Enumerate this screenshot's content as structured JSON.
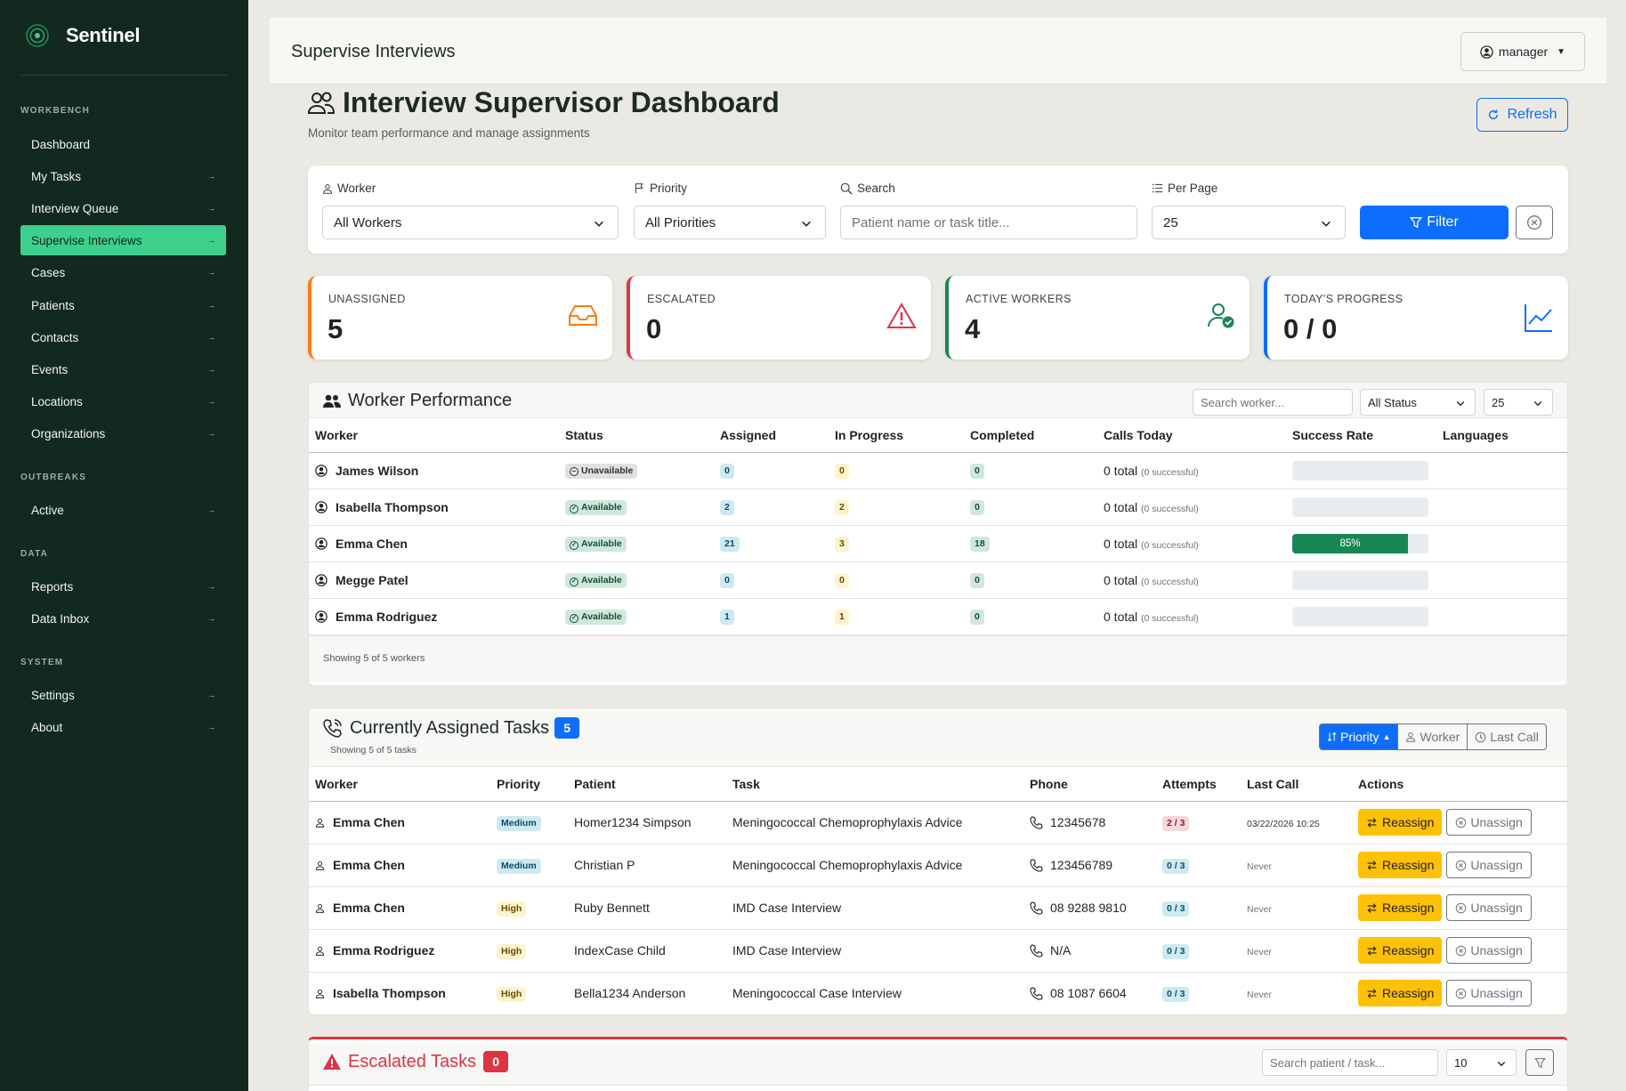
{
  "app": {
    "name": "Sentinel"
  },
  "sidebar": {
    "sections": [
      {
        "label": "WORKBENCH",
        "items": [
          "Dashboard",
          "My Tasks",
          "Interview Queue",
          "Supervise Interviews",
          "Cases",
          "Patients",
          "Contacts",
          "Events",
          "Locations",
          "Organizations"
        ]
      },
      {
        "label": "OUTBREAKS",
        "items": [
          "Active"
        ]
      },
      {
        "label": "DATA",
        "items": [
          "Reports",
          "Data Inbox"
        ]
      },
      {
        "label": "SYSTEM",
        "items": [
          "Settings",
          "About"
        ]
      }
    ],
    "active_item": "Supervise Interviews",
    "arrow": "→"
  },
  "topbar": {
    "title": "Supervise Interviews",
    "user": "manager"
  },
  "page": {
    "title": "Interview Supervisor Dashboard",
    "subtitle": "Monitor team performance and manage assignments",
    "refresh_label": "Refresh"
  },
  "filters": {
    "worker_label": "Worker",
    "worker_value": "All Workers",
    "priority_label": "Priority",
    "priority_value": "All Priorities",
    "search_label": "Search",
    "search_placeholder": "Patient name or task title...",
    "perpage_label": "Per Page",
    "perpage_value": "25",
    "filter_button": "Filter"
  },
  "stats": [
    {
      "label": "UNASSIGNED",
      "value": "5",
      "color": "#fd7e14",
      "icon": "inbox-icon"
    },
    {
      "label": "ESCALATED",
      "value": "0",
      "color": "#dc3545",
      "icon": "warning-icon"
    },
    {
      "label": "ACTIVE WORKERS",
      "value": "4",
      "color": "#198754",
      "icon": "user-check-icon"
    },
    {
      "label": "TODAY'S PROGRESS",
      "value": "0 / 0",
      "color": "#0d6efd",
      "icon": "chart-line-icon"
    }
  ],
  "worker_performance": {
    "title": "Worker Performance",
    "search_placeholder": "Search worker...",
    "status_filter": "All Status",
    "per_page": "25",
    "columns": [
      "Worker",
      "Status",
      "Assigned",
      "In Progress",
      "Completed",
      "Calls Today",
      "Success Rate",
      "Languages"
    ],
    "rows": [
      {
        "worker": "James Wilson",
        "status": "Unavailable",
        "assigned": "0",
        "in_progress": "0",
        "completed": "0",
        "calls": "0 total",
        "successful": "(0 successful)",
        "rate": 0,
        "rate_label": ""
      },
      {
        "worker": "Isabella Thompson",
        "status": "Available",
        "assigned": "2",
        "in_progress": "2",
        "completed": "0",
        "calls": "0 total",
        "successful": "(0 successful)",
        "rate": 0,
        "rate_label": ""
      },
      {
        "worker": "Emma Chen",
        "status": "Available",
        "assigned": "21",
        "in_progress": "3",
        "completed": "18",
        "calls": "0 total",
        "successful": "(0 successful)",
        "rate": 85,
        "rate_label": "85%"
      },
      {
        "worker": "Megge Patel",
        "status": "Available",
        "assigned": "0",
        "in_progress": "0",
        "completed": "0",
        "calls": "0 total",
        "successful": "(0 successful)",
        "rate": 0,
        "rate_label": ""
      },
      {
        "worker": "Emma Rodriguez",
        "status": "Available",
        "assigned": "1",
        "in_progress": "1",
        "completed": "0",
        "calls": "0 total",
        "successful": "(0 successful)",
        "rate": 0,
        "rate_label": ""
      }
    ],
    "footer": "Showing 5 of 5 workers"
  },
  "assigned_tasks": {
    "title": "Currently Assigned Tasks",
    "count": "5",
    "subtitle": "Showing 5 of 5 tasks",
    "sort_buttons": [
      "Priority",
      "Worker",
      "Last Call"
    ],
    "columns": [
      "Worker",
      "Priority",
      "Patient",
      "Task",
      "Phone",
      "Attempts",
      "Last Call",
      "Actions"
    ],
    "reassign_label": "Reassign",
    "unassign_label": "Unassign",
    "rows": [
      {
        "worker": "Emma Chen",
        "priority": "Medium",
        "patient": "Homer1234 Simpson",
        "task": "Meningococcal Chemoprophylaxis Advice",
        "phone": "12345678",
        "attempts": "2 / 3",
        "last_call": "03/22/2026 10:25"
      },
      {
        "worker": "Emma Chen",
        "priority": "Medium",
        "patient": "Christian P",
        "task": "Meningococcal Chemoprophylaxis Advice",
        "phone": "123456789",
        "attempts": "0 / 3",
        "last_call": "Never"
      },
      {
        "worker": "Emma Chen",
        "priority": "High",
        "patient": "Ruby Bennett",
        "task": "IMD Case Interview",
        "phone": "08 9288 9810",
        "attempts": "0 / 3",
        "last_call": "Never"
      },
      {
        "worker": "Emma Rodriguez",
        "priority": "High",
        "patient": "IndexCase Child",
        "task": "IMD Case Interview",
        "phone": "N/A",
        "attempts": "0 / 3",
        "last_call": "Never"
      },
      {
        "worker": "Isabella Thompson",
        "priority": "High",
        "patient": "Bella1234 Anderson",
        "task": "Meningococcal Case Interview",
        "phone": "08 1087 6604",
        "attempts": "0 / 3",
        "last_call": "Never"
      }
    ]
  },
  "escalated": {
    "title": "Escalated Tasks",
    "count": "0",
    "search_placeholder": "Search patient / task...",
    "per_page": "10"
  },
  "colors": {
    "sidebar_bg": "#11291f",
    "active_item": "#3dd08c",
    "primary": "#0d6efd",
    "warning": "#ffc107",
    "danger": "#dc3545",
    "success": "#198754"
  }
}
